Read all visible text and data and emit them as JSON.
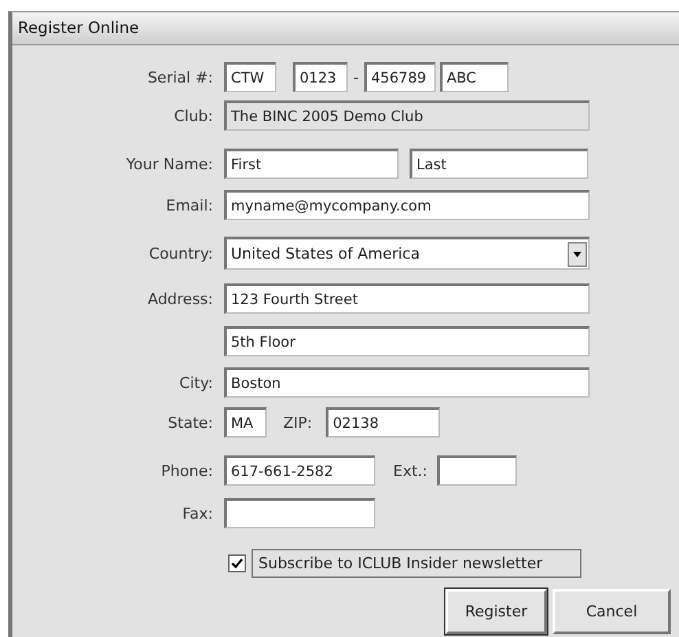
{
  "window": {
    "title": "Register Online"
  },
  "serial": {
    "label": "Serial #:",
    "parts": [
      {
        "value": "CTW"
      },
      {
        "value": "0123"
      },
      {
        "value": "456789"
      },
      {
        "value": "ABC"
      }
    ],
    "separator": "-"
  },
  "club": {
    "label": "Club:",
    "value": "The BINC 2005 Demo Club",
    "disabled": true
  },
  "name": {
    "label": "Your Name:",
    "first": "First",
    "last": "Last"
  },
  "email": {
    "label": "Email:",
    "value": "myname@mycompany.com"
  },
  "country": {
    "label": "Country:",
    "value": "United States of America"
  },
  "address": {
    "label": "Address:",
    "line1": "123 Fourth Street",
    "line2": "5th Floor"
  },
  "city": {
    "label": "City:",
    "value": "Boston"
  },
  "state": {
    "label": "State:",
    "value": "MA"
  },
  "zip": {
    "label": "ZIP:",
    "value": "02138"
  },
  "phone": {
    "label": "Phone:",
    "value": "617-661-2582"
  },
  "ext": {
    "label": "Ext.:"
  },
  "fax": {
    "label": "Fax:"
  },
  "subscribe": {
    "label": "Subscribe to ICLUB Insider newsletter",
    "checked": true
  },
  "buttons": [
    {
      "label": "Register",
      "kind": "default"
    },
    {
      "label": "Cancel",
      "kind": "normal"
    }
  ]
}
